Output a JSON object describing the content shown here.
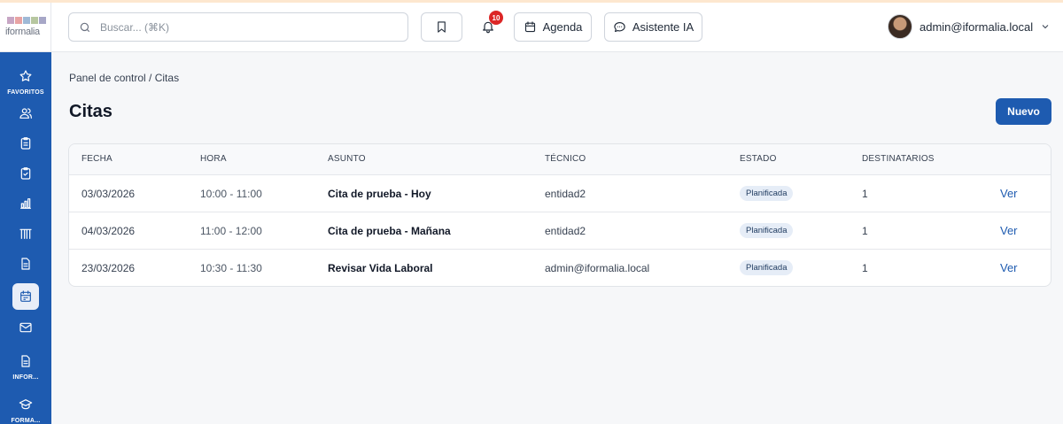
{
  "app": {
    "logo_text": "iformalia",
    "logo_tiles": [
      "#c7a6c4",
      "#e8a3a3",
      "#9fb9d6",
      "#b7c7a0",
      "#a7a7c7"
    ]
  },
  "sidebar": {
    "items": [
      {
        "icon": "star-icon",
        "label": "FAVORITOS"
      },
      {
        "icon": "users-icon",
        "label": ""
      },
      {
        "icon": "clipboard-icon",
        "label": ""
      },
      {
        "icon": "clipboard-check-icon",
        "label": ""
      },
      {
        "icon": "bar-chart-icon",
        "label": ""
      },
      {
        "icon": "columns-icon",
        "label": ""
      },
      {
        "icon": "document-icon",
        "label": ""
      },
      {
        "icon": "calendar-icon",
        "label": "",
        "active": true
      },
      {
        "icon": "mail-icon",
        "label": ""
      },
      {
        "icon": "report-icon",
        "label": "INFOR..."
      },
      {
        "icon": "graduation-cap-icon",
        "label": "FORMA..."
      }
    ]
  },
  "header": {
    "search_placeholder": "Buscar... (⌘K)",
    "notification_count": "10",
    "agenda_label": "Agenda",
    "assistant_label": "Asistente IA",
    "user_name": "admin@iformalia.local"
  },
  "main": {
    "breadcrumb": "Panel de control / Citas",
    "title": "Citas",
    "new_button": "Nuevo"
  },
  "table": {
    "columns": [
      "FECHA",
      "HORA",
      "ASUNTO",
      "TÉCNICO",
      "ESTADO",
      "DESTINATARIOS"
    ],
    "rows": [
      {
        "fecha": "03/03/2026",
        "hora": "10:00 - 11:00",
        "asunto": "Cita de prueba - Hoy",
        "tecnico": "entidad2",
        "estado": "Planificada",
        "destinatarios": "1",
        "accion": "Ver"
      },
      {
        "fecha": "04/03/2026",
        "hora": "11:00 - 12:00",
        "asunto": "Cita de prueba - Mañana",
        "tecnico": "entidad2",
        "estado": "Planificada",
        "destinatarios": "1",
        "accion": "Ver"
      },
      {
        "fecha": "23/03/2026",
        "hora": "10:30 - 11:30",
        "asunto": "Revisar Vida Laboral",
        "tecnico": "admin@iformalia.local",
        "estado": "Planificada",
        "destinatarios": "1",
        "accion": "Ver"
      }
    ]
  },
  "colors": {
    "brand": "#1e5bb0",
    "badge": "#dc2626",
    "status_bg": "#e6edf7"
  }
}
